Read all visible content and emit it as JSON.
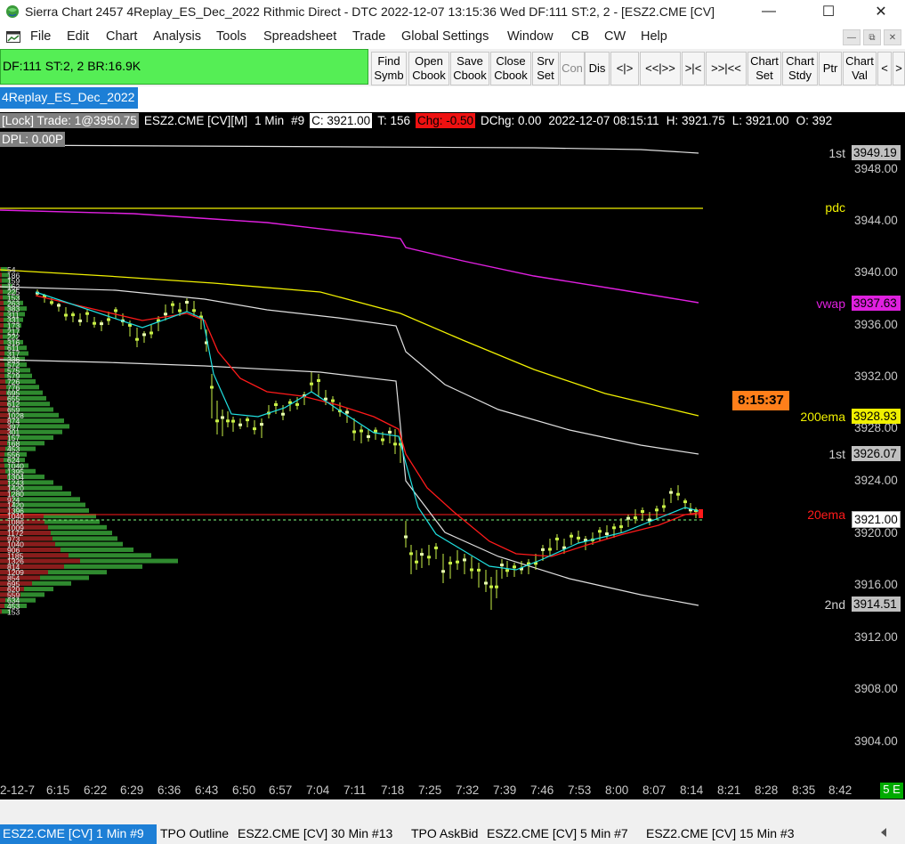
{
  "window": {
    "title": "Sierra Chart 2457 4Replay_ES_Dec_2022  Rithmic Direct - DTC 2022-12-07  13:15:36 Wed  DF:111  ST:2, 2 - [ESZ2.CME [CV]",
    "minimize_glyph": "—",
    "maximize_glyph": "☐",
    "close_glyph": "✕"
  },
  "menu": [
    "File",
    "Edit",
    "Chart",
    "Analysis",
    "Tools",
    "Spreadsheet",
    "Trade",
    "Global Settings",
    "Window",
    "CB",
    "CW",
    "Help"
  ],
  "mdi_controls": [
    "—",
    "⧉",
    "✕"
  ],
  "control_bar": {
    "status_text": "DF:111  ST:2, 2  BR:16.9K",
    "buttons": [
      {
        "label": "Find\nSymb",
        "name": "find-symbol-button"
      },
      {
        "label": "Open\nCbook",
        "name": "open-cbook-button"
      },
      {
        "label": "Save\nCbook",
        "name": "save-cbook-button"
      },
      {
        "label": "Close\nCbook",
        "name": "close-cbook-button"
      },
      {
        "label": "Srv\nSet",
        "name": "server-settings-button"
      },
      {
        "label": "Con",
        "name": "connect-button"
      },
      {
        "label": "Dis",
        "name": "disconnect-button"
      },
      {
        "label": "<|>",
        "name": "center-button"
      },
      {
        "label": "<<|>>",
        "name": "scroll-button"
      },
      {
        "label": ">|<",
        "name": "compress-button"
      },
      {
        "label": ">>|<<",
        "name": "expand-button"
      },
      {
        "label": "Chart\nSet",
        "name": "chart-settings-button"
      },
      {
        "label": "Chart\nStdy",
        "name": "chart-studies-button"
      },
      {
        "label": "Ptr",
        "name": "pointer-button"
      },
      {
        "label": "Chart\nVal",
        "name": "chart-values-button"
      },
      {
        "label": "<",
        "name": "toolbar-left-button"
      },
      {
        "label": ">",
        "name": "toolbar-right-button"
      }
    ]
  },
  "chartbook_tab": "4Replay_ES_Dec_2022",
  "info_bar": {
    "lock_trade": "[Lock] Trade: 1@3950.75",
    "symbol": "ESZ2.CME [CV][M]",
    "interval": "1 Min",
    "chart_number": "#9",
    "close": "C: 3921.00",
    "ticks": "T: 156",
    "change": "Chg: -0.50",
    "dchange": "DChg: 0.00",
    "datetime": "2022-12-07 08:15:11",
    "high": "H: 3921.75",
    "low": "L: 3921.00",
    "open": "O: 392",
    "dpl": "DPL: 0.00P"
  },
  "price_axis": {
    "ticks": [
      "3948.00",
      "3944.00",
      "3940.00",
      "3936.00",
      "3932.00",
      "3928.00",
      "3924.00",
      "3920.00",
      "3916.00",
      "3912.00",
      "3908.00",
      "3904.00"
    ],
    "labels": [
      {
        "text": "3949.19",
        "line": "1st",
        "color": "#ffffff",
        "bg": "#c0c0c0",
        "fg": "#000000"
      },
      {
        "text": "3937.63",
        "line": "vwap",
        "color": "#e020e0",
        "bg": "#e020e0",
        "fg": "#000000"
      },
      {
        "text": "3928.93",
        "line": "200ema",
        "color": "#f0f000",
        "bg": "#f0f000",
        "fg": "#000000"
      },
      {
        "text": "3926.07",
        "line": "1st",
        "color": "#ffffff",
        "bg": "#c0c0c0",
        "fg": "#000000"
      },
      {
        "text": "3921.00",
        "line": "20ema",
        "color": "#ff1010",
        "bg": "#ffffff",
        "fg": "#000000"
      },
      {
        "text": "3914.51",
        "line": "2nd",
        "color": "#ffffff",
        "bg": "#c0c0c0",
        "fg": "#000000"
      }
    ],
    "pdc_label": "pdc",
    "pdc_color": "#f0f000"
  },
  "bar_timer": "8:15:37",
  "time_axis": [
    "2-12-7",
    "6:15",
    "6:22",
    "6:29",
    "6:36",
    "6:43",
    "6:50",
    "6:57",
    "7:04",
    "7:11",
    "7:18",
    "7:25",
    "7:32",
    "7:39",
    "7:46",
    "7:53",
    "8:00",
    "8:07",
    "8:14",
    "8:21",
    "8:28",
    "8:35",
    "8:42"
  ],
  "time_axis_badge": "5 E",
  "bottom_tabs": [
    {
      "label": "ESZ2.CME [CV]  1 Min   #9",
      "active": true
    },
    {
      "label": "TPO Outline",
      "active": false
    },
    {
      "label": "ESZ2.CME [CV]  30 Min   #13",
      "active": false
    },
    {
      "label": "TPO AskBid",
      "active": false
    },
    {
      "label": "ESZ2.CME [CV]  5 Min   #7",
      "active": false
    },
    {
      "label": "ESZ2.CME [CV]  15 Min   #3",
      "active": false
    }
  ],
  "volume_profile_labels": [
    "54",
    "186",
    "159",
    "162",
    "225",
    "153",
    "263",
    "383",
    "311",
    "331",
    "173",
    "217",
    "222",
    "316",
    "611",
    "317",
    "336",
    "572",
    "575",
    "579",
    "726",
    "776",
    "695",
    "655",
    "612",
    "659",
    "1028",
    "874",
    "397",
    "301",
    "157",
    "168",
    "453",
    "556",
    "624",
    "1040",
    "1395",
    "1304",
    "1243",
    "1420",
    "1280",
    "924",
    "1420",
    "1396",
    "1040",
    "1086",
    "1009",
    "1172",
    "973",
    "1040",
    "906",
    "1185",
    "1326",
    "814",
    "1209",
    "854",
    "695",
    "620",
    "559",
    "634",
    "453",
    "153"
  ],
  "colors": {
    "chart_bg": "#000000",
    "candle": "#c8f046",
    "ema20": "#ff1a1a",
    "fast_ma": "#20e0e0",
    "vwap": "#e020e0",
    "ema200": "#f0f000",
    "band": "#e0e0e0",
    "profile_green": "#2f8a2f",
    "profile_red": "#8a1c1c"
  }
}
